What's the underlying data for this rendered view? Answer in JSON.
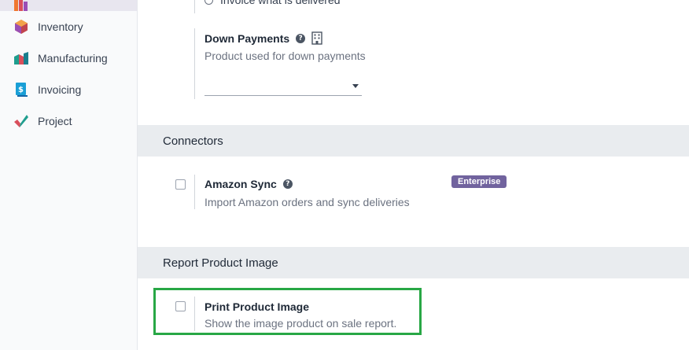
{
  "sidebar": {
    "items": [
      {
        "label": "Inventory",
        "icon": "inventory-app-icon"
      },
      {
        "label": "Manufacturing",
        "icon": "manufacturing-app-icon"
      },
      {
        "label": "Invoicing",
        "icon": "invoicing-app-icon"
      },
      {
        "label": "Project",
        "icon": "project-app-icon"
      }
    ]
  },
  "invoicing_policy": {
    "option_delivered": "Invoice what is delivered"
  },
  "down_payments": {
    "title": "Down Payments",
    "description": "Product used for down payments",
    "selected_value": ""
  },
  "sections": {
    "connectors": "Connectors",
    "report_product_image": "Report Product Image"
  },
  "amazon_sync": {
    "title": "Amazon Sync",
    "description": "Import Amazon orders and sync deliveries",
    "badge": "Enterprise",
    "checked": false
  },
  "print_product_image": {
    "title": "Print Product Image",
    "description": "Show the image product on sale report.",
    "checked": false
  },
  "colors": {
    "highlight": "#28a745",
    "enterprise_badge": "#71639e",
    "section_header_bg": "#e9ecef"
  }
}
